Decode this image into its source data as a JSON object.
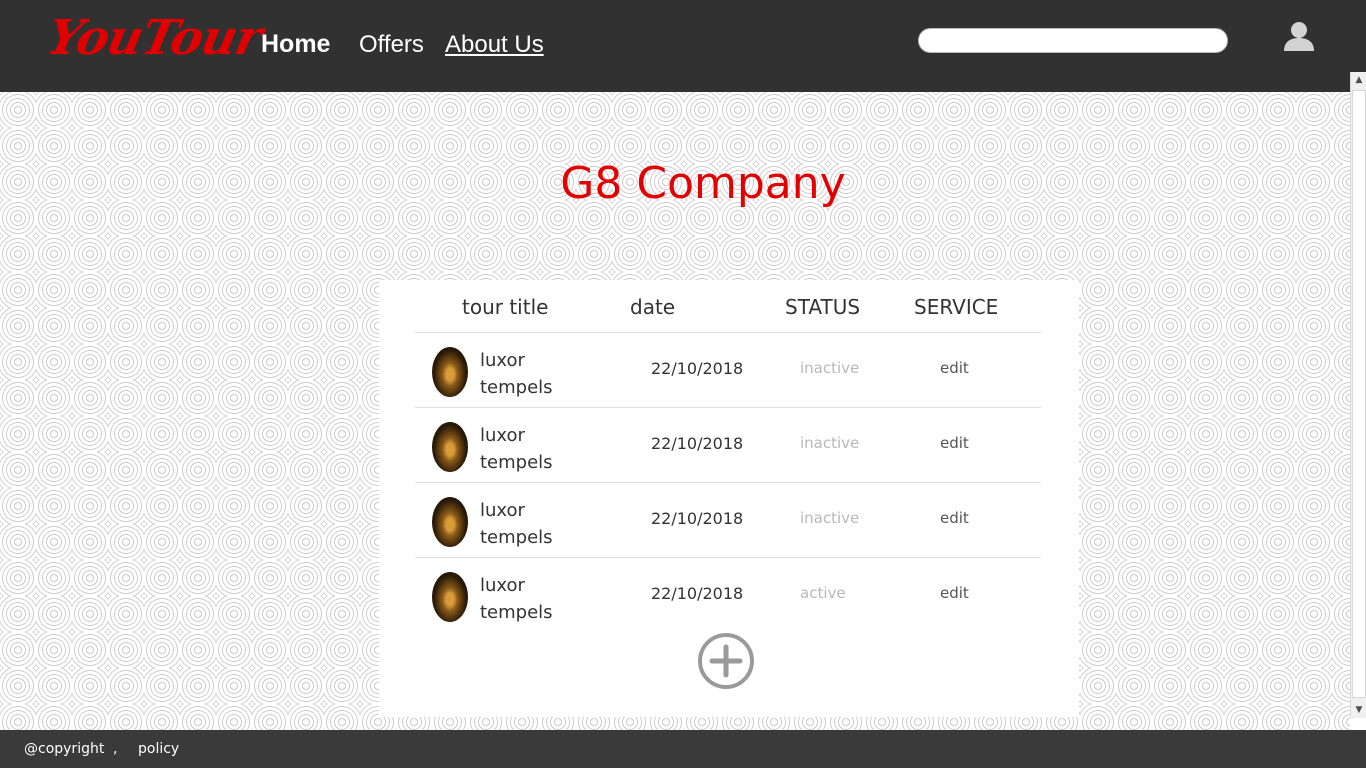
{
  "header": {
    "logo": "YouTour",
    "nav": {
      "home": "Home",
      "offers": "Offers",
      "about": "About Us"
    },
    "search_placeholder": "",
    "user_icon": "user-icon"
  },
  "main": {
    "company_title": "G8 Company",
    "table": {
      "headers": {
        "title": "tour title",
        "date": "date",
        "status": "STATUS",
        "service": "SERVICE"
      },
      "rows": [
        {
          "title": "luxor tempels",
          "date": "22/10/2018",
          "status": "inactive",
          "action": "edit"
        },
        {
          "title": "luxor tempels",
          "date": "22/10/2018",
          "status": "inactive",
          "action": "edit"
        },
        {
          "title": "luxor tempels",
          "date": "22/10/2018",
          "status": "inactive",
          "action": "edit"
        },
        {
          "title": "luxor tempels",
          "date": "22/10/2018",
          "status": "active",
          "action": "edit"
        }
      ]
    },
    "add_icon": "plus-circle-icon"
  },
  "footer": {
    "copyright": "@copyright",
    "separator": ",",
    "policy": "policy"
  },
  "colors": {
    "accent": "#e20000",
    "navbar": "#313131",
    "footer": "#3a3a3a"
  }
}
